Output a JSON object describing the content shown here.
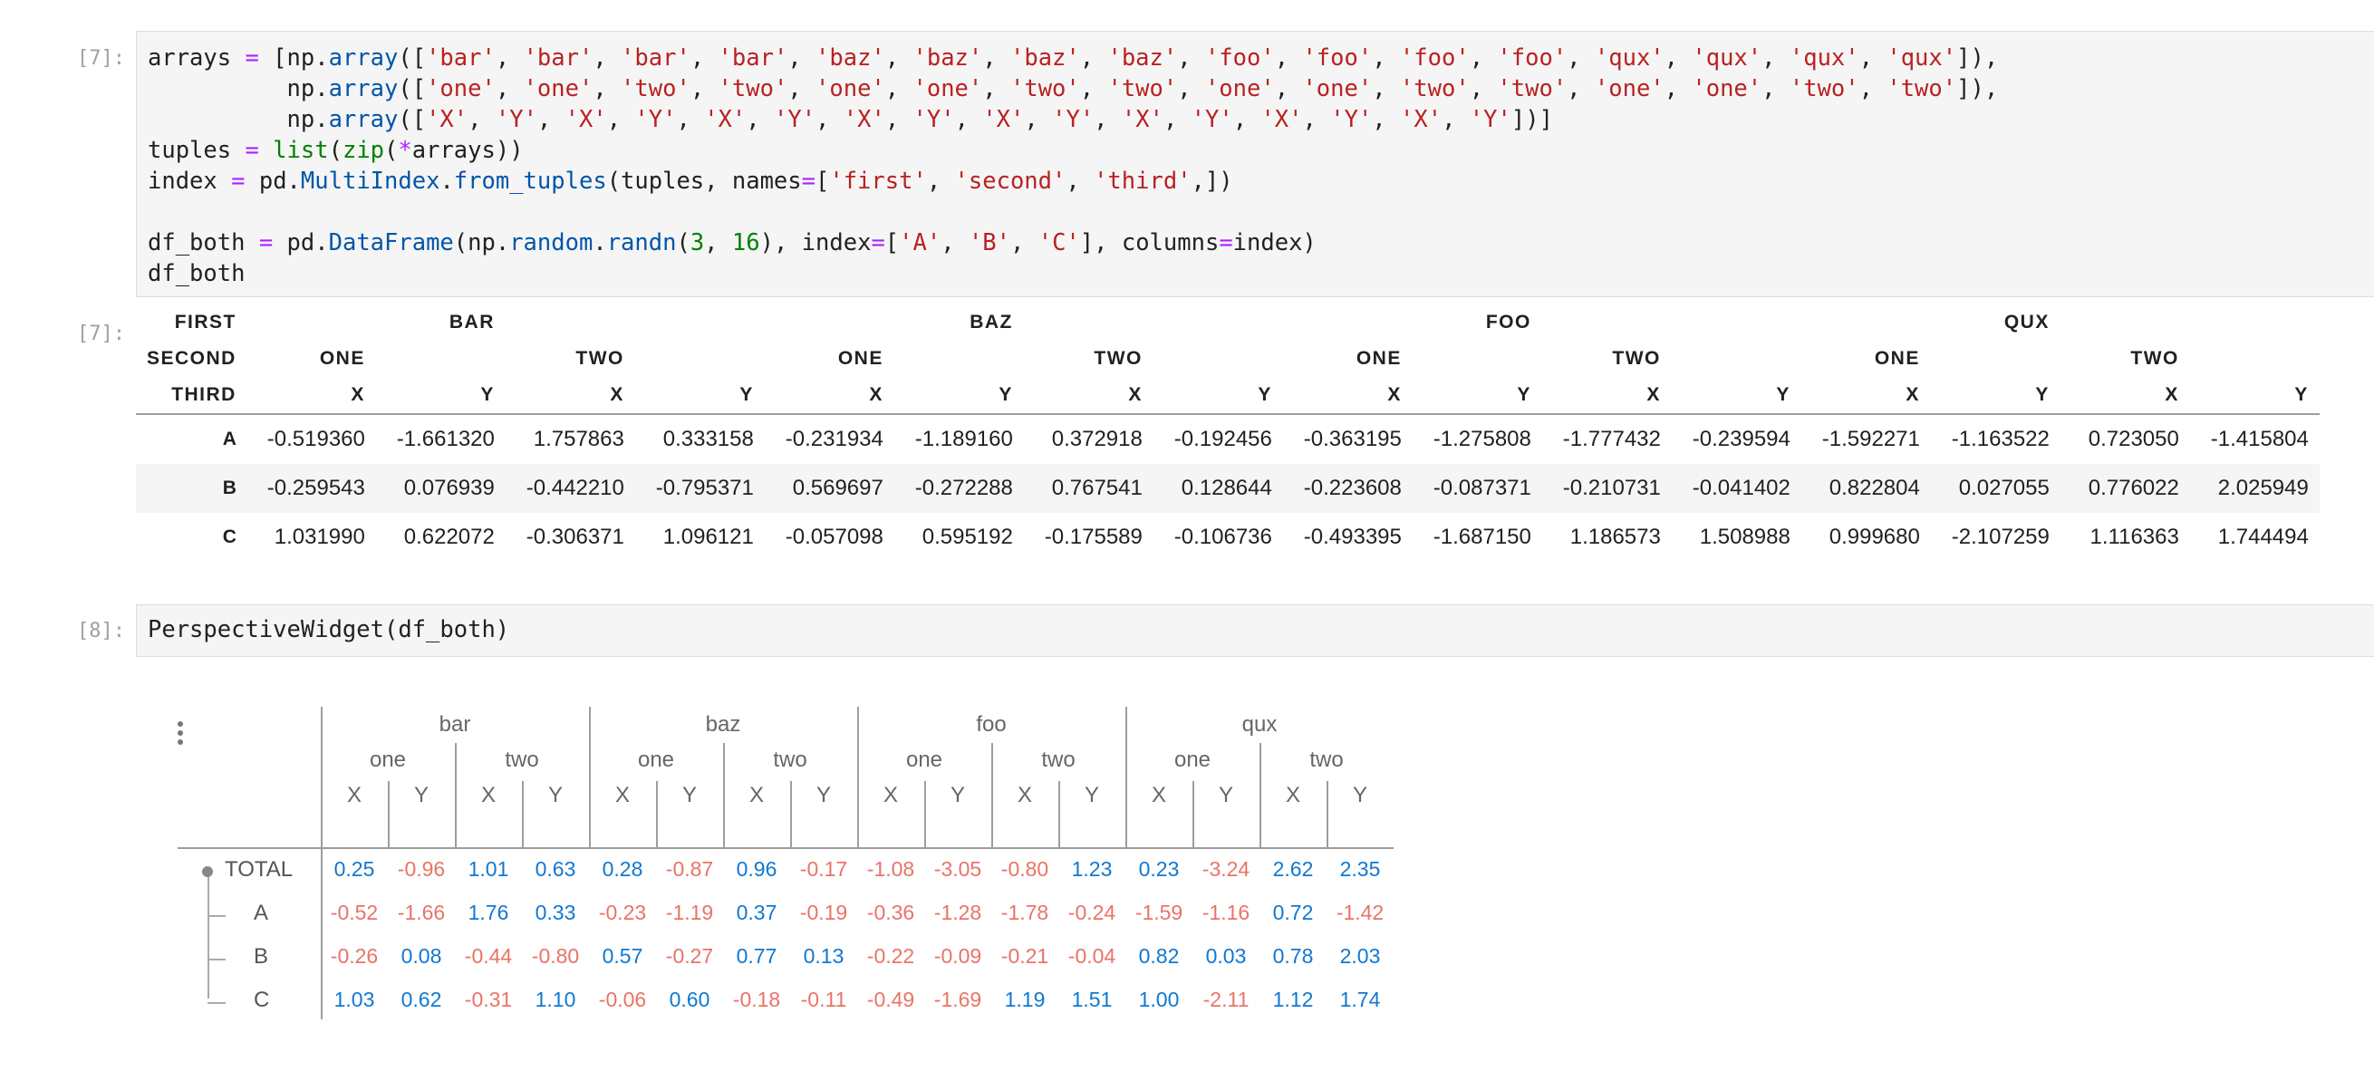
{
  "cells": [
    {
      "prompt": "[7]:",
      "code_lines": [
        [
          [
            "arrays ",
            ""
          ],
          [
            "=",
            "o"
          ],
          [
            " [np.",
            ""
          ],
          [
            "array",
            "f"
          ],
          [
            "([",
            ""
          ],
          [
            "'bar'",
            "s"
          ],
          [
            ", ",
            ""
          ],
          [
            "'bar'",
            "s"
          ],
          [
            ", ",
            ""
          ],
          [
            "'bar'",
            "s"
          ],
          [
            ", ",
            ""
          ],
          [
            "'bar'",
            "s"
          ],
          [
            ", ",
            ""
          ],
          [
            "'baz'",
            "s"
          ],
          [
            ", ",
            ""
          ],
          [
            "'baz'",
            "s"
          ],
          [
            ", ",
            ""
          ],
          [
            "'baz'",
            "s"
          ],
          [
            ", ",
            ""
          ],
          [
            "'baz'",
            "s"
          ],
          [
            ", ",
            ""
          ],
          [
            "'foo'",
            "s"
          ],
          [
            ", ",
            ""
          ],
          [
            "'foo'",
            "s"
          ],
          [
            ", ",
            ""
          ],
          [
            "'foo'",
            "s"
          ],
          [
            ", ",
            ""
          ],
          [
            "'foo'",
            "s"
          ],
          [
            ", ",
            ""
          ],
          [
            "'qux'",
            "s"
          ],
          [
            ", ",
            ""
          ],
          [
            "'qux'",
            "s"
          ],
          [
            ", ",
            ""
          ],
          [
            "'qux'",
            "s"
          ],
          [
            ", ",
            ""
          ],
          [
            "'qux'",
            "s"
          ],
          [
            "]),",
            ""
          ]
        ],
        [
          [
            "          np.",
            ""
          ],
          [
            "array",
            "f"
          ],
          [
            "([",
            ""
          ],
          [
            "'one'",
            "s"
          ],
          [
            ", ",
            ""
          ],
          [
            "'one'",
            "s"
          ],
          [
            ", ",
            ""
          ],
          [
            "'two'",
            "s"
          ],
          [
            ", ",
            ""
          ],
          [
            "'two'",
            "s"
          ],
          [
            ", ",
            ""
          ],
          [
            "'one'",
            "s"
          ],
          [
            ", ",
            ""
          ],
          [
            "'one'",
            "s"
          ],
          [
            ", ",
            ""
          ],
          [
            "'two'",
            "s"
          ],
          [
            ", ",
            ""
          ],
          [
            "'two'",
            "s"
          ],
          [
            ", ",
            ""
          ],
          [
            "'one'",
            "s"
          ],
          [
            ", ",
            ""
          ],
          [
            "'one'",
            "s"
          ],
          [
            ", ",
            ""
          ],
          [
            "'two'",
            "s"
          ],
          [
            ", ",
            ""
          ],
          [
            "'two'",
            "s"
          ],
          [
            ", ",
            ""
          ],
          [
            "'one'",
            "s"
          ],
          [
            ", ",
            ""
          ],
          [
            "'one'",
            "s"
          ],
          [
            ", ",
            ""
          ],
          [
            "'two'",
            "s"
          ],
          [
            ", ",
            ""
          ],
          [
            "'two'",
            "s"
          ],
          [
            "]),",
            ""
          ]
        ],
        [
          [
            "          np.",
            ""
          ],
          [
            "array",
            "f"
          ],
          [
            "([",
            ""
          ],
          [
            "'X'",
            "s"
          ],
          [
            ", ",
            ""
          ],
          [
            "'Y'",
            "s"
          ],
          [
            ", ",
            ""
          ],
          [
            "'X'",
            "s"
          ],
          [
            ", ",
            ""
          ],
          [
            "'Y'",
            "s"
          ],
          [
            ", ",
            ""
          ],
          [
            "'X'",
            "s"
          ],
          [
            ", ",
            ""
          ],
          [
            "'Y'",
            "s"
          ],
          [
            ", ",
            ""
          ],
          [
            "'X'",
            "s"
          ],
          [
            ", ",
            ""
          ],
          [
            "'Y'",
            "s"
          ],
          [
            ", ",
            ""
          ],
          [
            "'X'",
            "s"
          ],
          [
            ", ",
            ""
          ],
          [
            "'Y'",
            "s"
          ],
          [
            ", ",
            ""
          ],
          [
            "'X'",
            "s"
          ],
          [
            ", ",
            ""
          ],
          [
            "'Y'",
            "s"
          ],
          [
            ", ",
            ""
          ],
          [
            "'X'",
            "s"
          ],
          [
            ", ",
            ""
          ],
          [
            "'Y'",
            "s"
          ],
          [
            ", ",
            ""
          ],
          [
            "'X'",
            "s"
          ],
          [
            ", ",
            ""
          ],
          [
            "'Y'",
            "s"
          ],
          [
            "])]",
            ""
          ]
        ],
        [
          [
            "tuples ",
            ""
          ],
          [
            "=",
            "o"
          ],
          [
            " ",
            ""
          ],
          [
            "list",
            "n"
          ],
          [
            "(",
            ""
          ],
          [
            "zip",
            "n"
          ],
          [
            "(",
            ""
          ],
          [
            "*",
            "o"
          ],
          [
            "arrays))",
            ""
          ]
        ],
        [
          [
            "index ",
            ""
          ],
          [
            "=",
            "o"
          ],
          [
            " pd.",
            ""
          ],
          [
            "MultiIndex",
            "f"
          ],
          [
            ".",
            ""
          ],
          [
            "from_tuples",
            "f"
          ],
          [
            "(tuples, names",
            ""
          ],
          [
            "=",
            "o"
          ],
          [
            "[",
            ""
          ],
          [
            "'first'",
            "s"
          ],
          [
            ", ",
            ""
          ],
          [
            "'second'",
            "s"
          ],
          [
            ", ",
            ""
          ],
          [
            "'third'",
            "s"
          ],
          [
            ",])",
            ""
          ]
        ],
        [
          [
            "",
            ""
          ]
        ],
        [
          [
            "df_both ",
            ""
          ],
          [
            "=",
            "o"
          ],
          [
            " pd.",
            ""
          ],
          [
            "DataFrame",
            "f"
          ],
          [
            "(np.",
            ""
          ],
          [
            "random",
            "f"
          ],
          [
            ".",
            ""
          ],
          [
            "randn",
            "f"
          ],
          [
            "(",
            ""
          ],
          [
            "3",
            "n"
          ],
          [
            ", ",
            ""
          ],
          [
            "16",
            "n"
          ],
          [
            "), index",
            ""
          ],
          [
            "=",
            "o"
          ],
          [
            "[",
            ""
          ],
          [
            "'A'",
            "s"
          ],
          [
            ", ",
            ""
          ],
          [
            "'B'",
            "s"
          ],
          [
            ", ",
            ""
          ],
          [
            "'C'",
            "s"
          ],
          [
            "], columns",
            ""
          ],
          [
            "=",
            "o"
          ],
          [
            "index)",
            ""
          ]
        ],
        [
          [
            "df_both",
            ""
          ]
        ]
      ]
    },
    {
      "prompt": "[8]:",
      "code_lines": [
        [
          [
            "PerspectiveWidget(df_both)",
            ""
          ]
        ]
      ]
    }
  ],
  "output_prompt": "[7]:",
  "dataframe": {
    "level_names": [
      "FIRST",
      "SECOND",
      "THIRD"
    ],
    "first": [
      "",
      "BAR",
      "",
      "",
      "",
      "BAZ",
      "",
      "",
      "",
      "FOO",
      "",
      "",
      "",
      "QUX",
      "",
      ""
    ],
    "second": [
      "ONE",
      "",
      "TWO",
      "",
      "ONE",
      "",
      "TWO",
      "",
      "ONE",
      "",
      "TWO",
      "",
      "ONE",
      "",
      "TWO",
      ""
    ],
    "third": [
      "X",
      "Y",
      "X",
      "Y",
      "X",
      "Y",
      "X",
      "Y",
      "X",
      "Y",
      "X",
      "Y",
      "X",
      "Y",
      "X",
      "Y"
    ],
    "rows": [
      {
        "label": "A",
        "values": [
          "-0.519360",
          "-1.661320",
          "1.757863",
          "0.333158",
          "-0.231934",
          "-1.189160",
          "0.372918",
          "-0.192456",
          "-0.363195",
          "-1.275808",
          "-1.777432",
          "-0.239594",
          "-1.592271",
          "-1.163522",
          "0.723050",
          "-1.415804"
        ]
      },
      {
        "label": "B",
        "values": [
          "-0.259543",
          "0.076939",
          "-0.442210",
          "-0.795371",
          "0.569697",
          "-0.272288",
          "0.767541",
          "0.128644",
          "-0.223608",
          "-0.087371",
          "-0.210731",
          "-0.041402",
          "0.822804",
          "0.027055",
          "0.776022",
          "2.025949"
        ]
      },
      {
        "label": "C",
        "values": [
          "1.031990",
          "0.622072",
          "-0.306371",
          "1.096121",
          "-0.057098",
          "0.595192",
          "-0.175589",
          "-0.106736",
          "-0.493395",
          "-1.687150",
          "1.186573",
          "1.508988",
          "0.999680",
          "-2.107259",
          "1.116363",
          "1.744494"
        ]
      }
    ]
  },
  "perspective": {
    "groups": [
      "bar",
      "baz",
      "foo",
      "qux"
    ],
    "subgroups": [
      "one",
      "two"
    ],
    "leaves": [
      "X",
      "Y"
    ],
    "rows": [
      {
        "label": "TOTAL",
        "values": [
          "0.25",
          "-0.96",
          "1.01",
          "0.63",
          "0.28",
          "-0.87",
          "0.96",
          "-0.17",
          "-1.08",
          "-3.05",
          "-0.80",
          "1.23",
          "0.23",
          "-3.24",
          "2.62",
          "2.35"
        ]
      },
      {
        "label": "A",
        "values": [
          "-0.52",
          "-1.66",
          "1.76",
          "0.33",
          "-0.23",
          "-1.19",
          "0.37",
          "-0.19",
          "-0.36",
          "-1.28",
          "-1.78",
          "-0.24",
          "-1.59",
          "-1.16",
          "0.72",
          "-1.42"
        ]
      },
      {
        "label": "B",
        "values": [
          "-0.26",
          "0.08",
          "-0.44",
          "-0.80",
          "0.57",
          "-0.27",
          "0.77",
          "0.13",
          "-0.22",
          "-0.09",
          "-0.21",
          "-0.04",
          "0.82",
          "0.03",
          "0.78",
          "2.03"
        ]
      },
      {
        "label": "C",
        "values": [
          "1.03",
          "0.62",
          "-0.31",
          "1.10",
          "-0.06",
          "0.60",
          "-0.18",
          "-0.11",
          "-0.49",
          "-1.69",
          "1.19",
          "1.51",
          "1.00",
          "-2.11",
          "1.12",
          "1.74"
        ]
      }
    ],
    "colors": {
      "positive": "#1078d1",
      "negative": "#ea7367"
    },
    "menu_icon": "more-vertical-icon"
  }
}
